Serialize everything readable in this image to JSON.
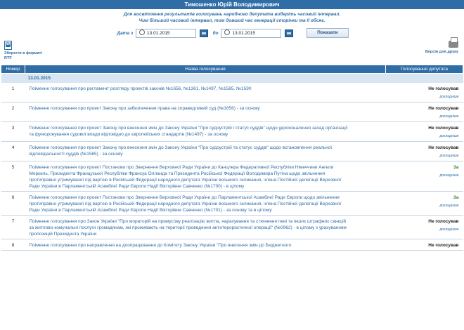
{
  "header": {
    "title": "Тимошенко Юрій Володимирович"
  },
  "info": {
    "line1": "Для висвітлення результатів голосувань народного депутата виберіть часовий інтервал.",
    "line2": "Чим більший часовий інтервал, тим довший час генерації сторінки та її обсяг."
  },
  "filter": {
    "from_label": "Дата з",
    "from_value": "13.01.2015",
    "to_label": "до",
    "to_value": "13.01.2015",
    "show_button": "Показати"
  },
  "actions": {
    "rtf_label": "Зберегти в форматі RTF",
    "print_label": "Версія для друку"
  },
  "table": {
    "columns": [
      "Номер",
      "Назва голосування",
      "Голосування депутата"
    ],
    "date_group": "13.01.2015",
    "more_label": "докладніше",
    "rows": [
      {
        "num": "1",
        "name": "Поіменне голосування про регламент розгляду проектів законів №1656, №1361, №1497, №1585, №1590",
        "result": "Не голосував",
        "kind": "ne"
      },
      {
        "num": "2",
        "name": "Поіменне голосування про проект Закону про забезпечення права на справедливий суд (№1656) - за основу",
        "result": "Не голосував",
        "kind": "ne"
      },
      {
        "num": "3",
        "name": "Поіменне голосування про проект Закону про внесення змін до Закону України \"Про судоустрій і статус суддів\" щодо удосконалення засад організації та функціонування судової влади відповідно до європейських стандартів (№1497) - за основу",
        "result": "Не голосував",
        "kind": "ne"
      },
      {
        "num": "4",
        "name": "Поіменне голосування про проект Закону про внесення змін до Закону України \"Про судоустрій та статус суддів\" щодо встановлення реальної відповідальності суддів (№1585) - за основу",
        "result": "Не голосував",
        "kind": "ne"
      },
      {
        "num": "5",
        "name": "Поіменне голосування про проект Постанови про Звернення Верховної Ради України до Канцлера Федеративної Республіки Німеччини Ангели Меркель, Президента Французької Республіки Франсуа Олланда та Президента Російської Федерації Володимира Путіна щодо звільнення протиправно утримуваної під вартою в Російській Федерації народного депутата України восьмого скликання, члена Постійної делегації Верховної Ради України в Парламентській Асамблеї Ради Європи Надії Вікторівни Савченко (№1700) - в цілому",
        "result": "За",
        "kind": "za"
      },
      {
        "num": "6",
        "name": "Поіменне голосування про проект Постанови про Звернення Верховної Ради України до Парламентської Асамблеї Ради Європи щодо звільнення протиправно утримуваної під вартою в Російській Федерації народного депутата України восьмого скликання, члена Постійної делегації Верховної Ради України в Парламентській Асамблеї Ради Європи Надії Вікторівни Савченко (№1701) - за основу та в цілому",
        "result": "За",
        "kind": "za"
      },
      {
        "num": "7",
        "name": "Поіменне голосування про Закон України \"Про мораторій на примусову реалізацію житла, нарахування та стягнення пені та інших штрафних санкцій за житлово-комунальні послуги громадянам, які проживають на території проведення антитерористичної операції\" (№0962) - в цілому з урахуванням пропозицій Президента України",
        "result": "Не голосував",
        "kind": "ne"
      },
      {
        "num": "8",
        "name": "Поіменне голосування про направлення на доопрацювання до Комітету Закону України \"Про внесення змін до Бюджетного",
        "result": "Не голосував",
        "kind": "ne"
      }
    ]
  }
}
